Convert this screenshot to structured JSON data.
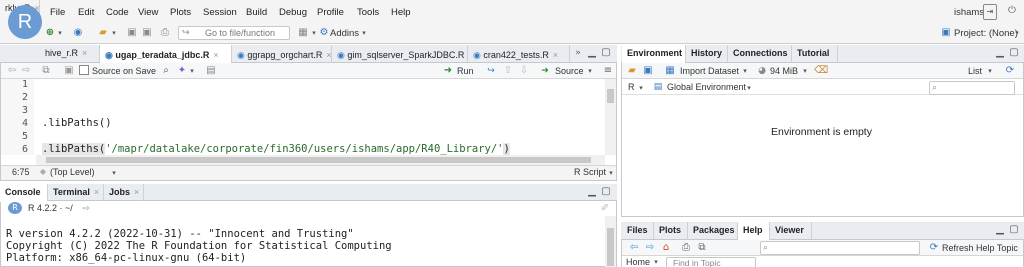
{
  "menubar": {
    "logo": "R",
    "items": [
      "File",
      "Edit",
      "Code",
      "View",
      "Plots",
      "Session",
      "Build",
      "Debug",
      "Profile",
      "Tools",
      "Help"
    ],
    "user": "ishams"
  },
  "toolbar": {
    "goto_placeholder": "Go to file/function",
    "addins_label": "Addins",
    "project_label": "Project: (None)"
  },
  "editor": {
    "tabs": [
      "rklyr.R",
      "hive_r.R",
      "ugap_teradata_jdbc.R",
      "ggrapg_orgchart.R",
      "gim_sqlserver_SparkJDBC.R",
      "cran422_tests.R"
    ],
    "source_on_save": "Source on Save",
    "run_label": "Run",
    "source_label": "Source",
    "line_numbers": [
      "1",
      "2",
      "3",
      "4",
      "5",
      "6"
    ],
    "line4": ".libPaths()",
    "line6_prefix": ".libPaths(",
    "line6_string": "'/mapr/datalake/corporate/fin360/users/ishams/app/R40_Library/'",
    "line6_suffix": ")",
    "cursor_pos": "6:75",
    "scope": "(Top Level)",
    "file_type": "R Script"
  },
  "console": {
    "tabs": [
      "Console",
      "Terminal",
      "Jobs"
    ],
    "version_path": "R 4.2.2 · ~/",
    "lines": [
      "R version 4.2.2 (2022-10-31) -- \"Innocent and Trusting\"",
      "Copyright (C) 2022 The R Foundation for Statistical Computing",
      "Platform: x86_64-pc-linux-gnu (64-bit)"
    ]
  },
  "environment": {
    "tabs": [
      "Environment",
      "History",
      "Connections",
      "Tutorial"
    ],
    "import_label": "Import Dataset",
    "memory": "94 MiB",
    "list_label": "List",
    "lang": "R",
    "scope_label": "Global Environment",
    "empty_message": "Environment is empty"
  },
  "help": {
    "tabs": [
      "Files",
      "Plots",
      "Packages",
      "Help",
      "Viewer"
    ],
    "refresh_label": "Refresh Help Topic",
    "home_label": "Home",
    "find_placeholder": "Find in Topic"
  }
}
